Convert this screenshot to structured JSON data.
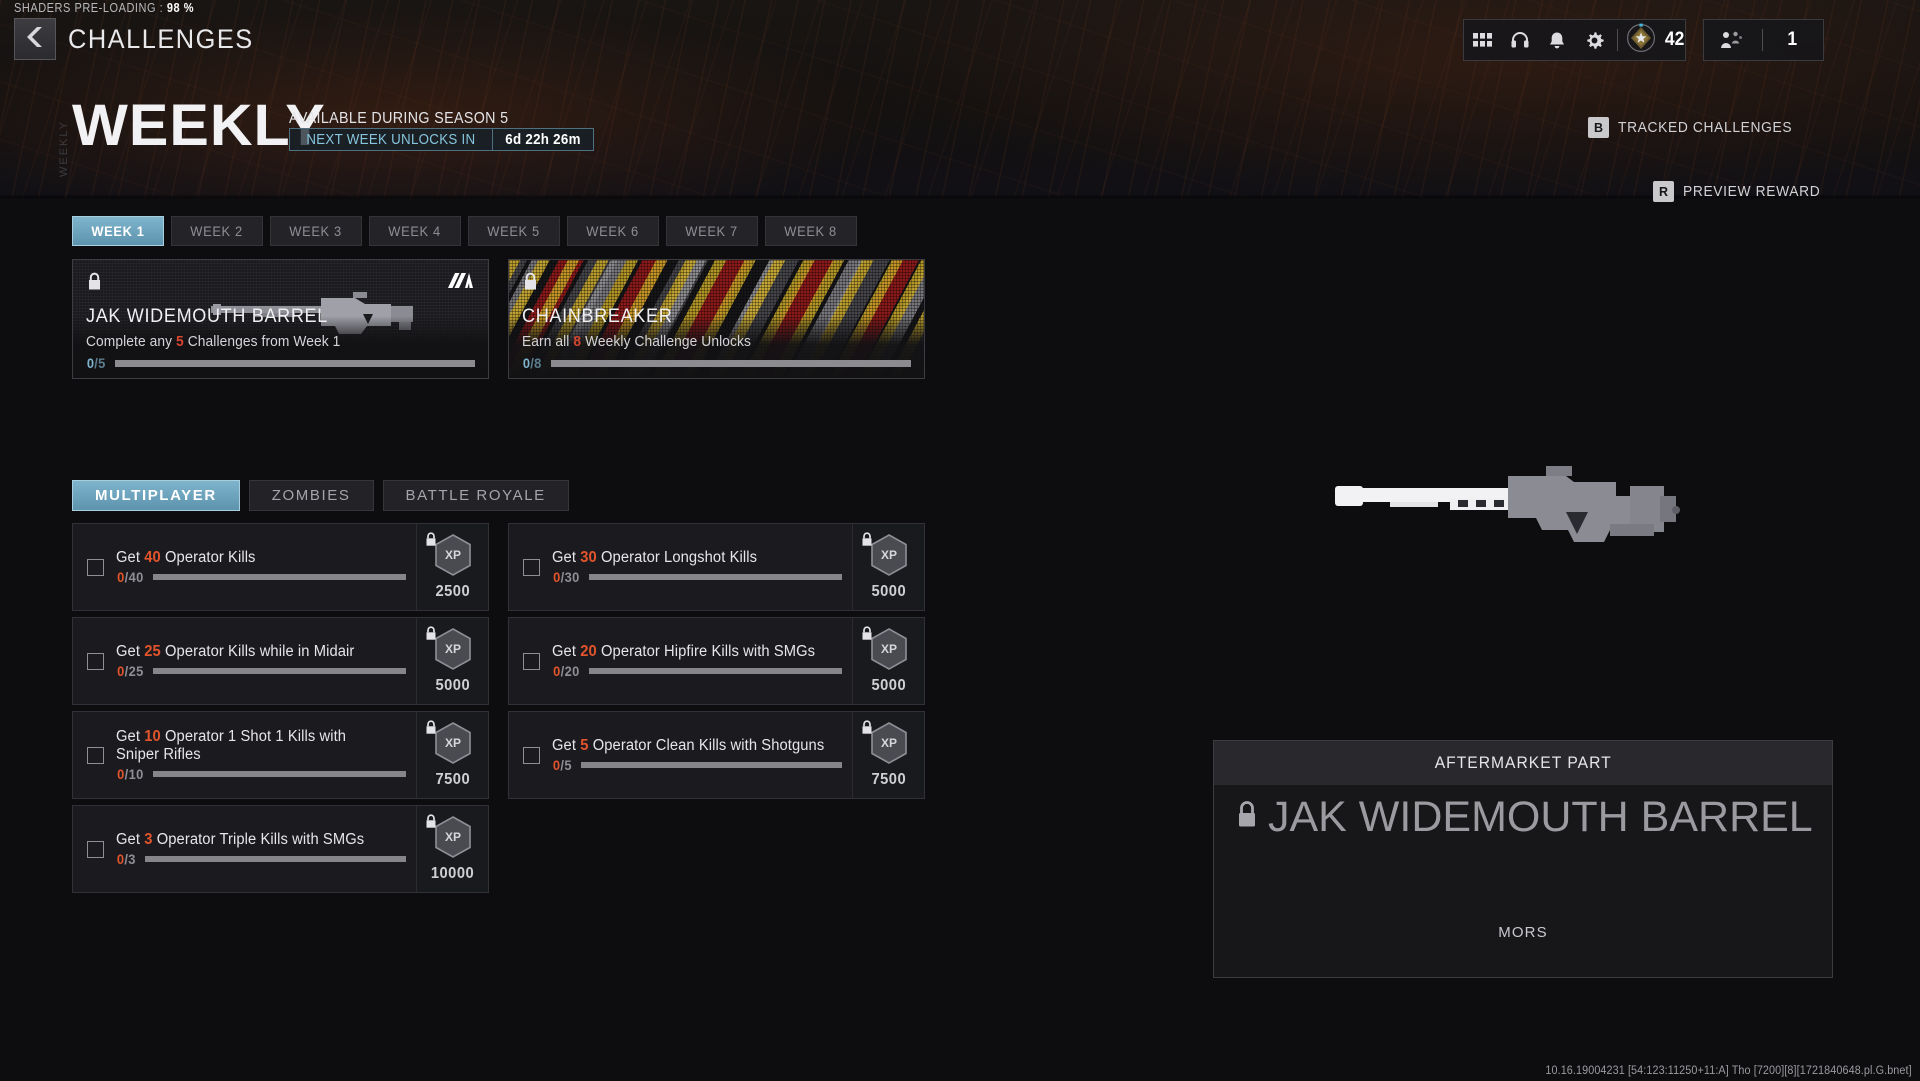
{
  "status": {
    "shaders_label": "SHADERS PRE-LOADING :",
    "shaders_pct": "98 %"
  },
  "header": {
    "back_icon": "chevron-left-icon",
    "title": "CHALLENGES",
    "icons": [
      "grid-menu-icon",
      "headphones-icon",
      "bell-icon",
      "gear-icon"
    ],
    "rank_icon": "prestige-emblem-icon",
    "rank_value": "42",
    "squad_icon": "squad-icon",
    "squad_value": "1"
  },
  "hero": {
    "ghost_text": "WEEKLY",
    "title": "WEEKLY",
    "available": "AVAILABLE DURING SEASON 5",
    "unlock_label": "NEXT WEEK UNLOCKS IN",
    "unlock_time": "6d 22h 26m",
    "tracked_key": "B",
    "tracked_label": "TRACKED CHALLENGES",
    "preview_key": "R",
    "preview_label": "PREVIEW REWARD"
  },
  "week_tabs": [
    {
      "label": "WEEK 1",
      "active": true
    },
    {
      "label": "WEEK 2",
      "active": false
    },
    {
      "label": "WEEK 3",
      "active": false
    },
    {
      "label": "WEEK 4",
      "active": false
    },
    {
      "label": "WEEK 5",
      "active": false
    },
    {
      "label": "WEEK 6",
      "active": false
    },
    {
      "label": "WEEK 7",
      "active": false
    },
    {
      "label": "WEEK 8",
      "active": false
    }
  ],
  "reward_cards": [
    {
      "name": "JAK WIDEMOUTH BARREL",
      "desc_pre": "Complete any ",
      "desc_hl": "5",
      "desc_post": " Challenges from Week 1",
      "current": "0",
      "total": "5",
      "progress_pct": 0,
      "locked": true,
      "lock_icon": "lock-icon",
      "brand_icon": "aftermarket-part-icon"
    },
    {
      "name": "CHAINBREAKER",
      "desc_pre": "Earn all ",
      "desc_hl": "8",
      "desc_post": " Weekly Challenge Unlocks",
      "current": "0",
      "total": "8",
      "progress_pct": 0,
      "locked": true,
      "lock_icon": "lock-icon"
    }
  ],
  "mode_tabs": [
    {
      "label": "MULTIPLAYER",
      "active": true
    },
    {
      "label": "ZOMBIES",
      "active": false
    },
    {
      "label": "BATTLE ROYALE",
      "active": false
    }
  ],
  "challenges_left": [
    {
      "pre": "Get ",
      "hl": "40",
      "post": " Operator Kills",
      "current": "0",
      "total": "40",
      "progress_pct": 0,
      "xp": "2500",
      "locked": true,
      "xp_icon": "xp-hex-icon",
      "lock_icon": "lock-icon"
    },
    {
      "pre": "Get ",
      "hl": "25",
      "post": " Operator Kills while in Midair",
      "current": "0",
      "total": "25",
      "progress_pct": 0,
      "xp": "5000",
      "locked": true,
      "xp_icon": "xp-hex-icon",
      "lock_icon": "lock-icon"
    },
    {
      "pre": "Get ",
      "hl": "10",
      "post": " Operator 1 Shot 1 Kills with Sniper Rifles",
      "current": "0",
      "total": "10",
      "progress_pct": 0,
      "xp": "7500",
      "locked": true,
      "xp_icon": "xp-hex-icon",
      "lock_icon": "lock-icon"
    },
    {
      "pre": "Get ",
      "hl": "3",
      "post": " Operator Triple Kills with SMGs",
      "current": "0",
      "total": "3",
      "progress_pct": 0,
      "xp": "10000",
      "locked": true,
      "xp_icon": "xp-hex-icon",
      "lock_icon": "lock-icon"
    }
  ],
  "challenges_right": [
    {
      "pre": "Get ",
      "hl": "30",
      "post": " Operator Longshot Kills",
      "current": "0",
      "total": "30",
      "progress_pct": 0,
      "xp": "5000",
      "locked": true,
      "xp_icon": "xp-hex-icon",
      "lock_icon": "lock-icon"
    },
    {
      "pre": "Get ",
      "hl": "20",
      "post": " Operator Hipfire Kills with SMGs",
      "current": "0",
      "total": "20",
      "progress_pct": 0,
      "xp": "5000",
      "locked": true,
      "xp_icon": "xp-hex-icon",
      "lock_icon": "lock-icon"
    },
    {
      "pre": "Get ",
      "hl": "5",
      "post": " Operator Clean Kills with Shotguns",
      "current": "0",
      "total": "5",
      "progress_pct": 0,
      "xp": "7500",
      "locked": true,
      "xp_icon": "xp-hex-icon",
      "lock_icon": "lock-icon"
    }
  ],
  "preview": {
    "weapon_icon": "sniper-rifle-icon",
    "amp_header": "AFTERMARKET PART",
    "amp_title": "JAK WIDEMOUTH BARREL",
    "amp_lock_icon": "lock-icon",
    "amp_weapon": "MORS"
  },
  "build_string": "10.16.19004231 [54:123:11250+11:A] Tho [7200][8][1721840648.pl.G.bnet]",
  "colors": {
    "accent_blue": "#7fb4cd",
    "accent_orange": "#e2542c",
    "accent_red": "#d8452f",
    "panel": "#1b1b1f"
  }
}
